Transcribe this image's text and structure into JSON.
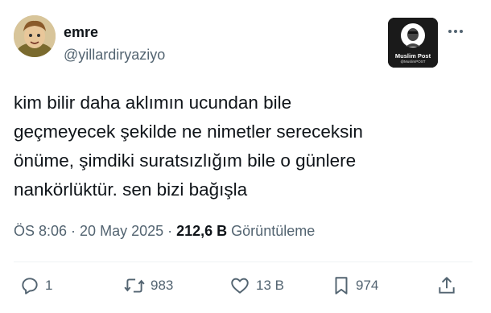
{
  "author": {
    "display_name": "emre",
    "handle": "@yillardiryaziyo",
    "avatar_icon": "cartoon-character-avatar"
  },
  "watermark_badge": {
    "brand": "Muslim Post",
    "sub": "@MuslimPOST"
  },
  "more_icon": "more-horizontal-icon",
  "tweet": {
    "lines": [
      "kim bilir daha aklımın ucundan bile",
      "geçmeyecek şekilde ne nimetler sereceksin",
      "önüme, şimdiki suratsızlığım bile o günlere",
      "nankörlüktür. sen bizi bağışla"
    ]
  },
  "meta": {
    "time": "ÖS 8:06",
    "sep1": " · ",
    "date": "20 May 2025",
    "sep2": " · ",
    "views_count": "212,6 B",
    "views_label": " Görüntüleme"
  },
  "actions": {
    "reply": {
      "icon": "reply-icon",
      "count": "1"
    },
    "retweet": {
      "icon": "retweet-icon",
      "count": "983"
    },
    "like": {
      "icon": "heart-icon",
      "count": "13 B"
    },
    "bookmark": {
      "icon": "bookmark-icon",
      "count": "974"
    },
    "share": {
      "icon": "share-icon"
    }
  },
  "colors": {
    "text": "#0f1419",
    "secondary": "#536471",
    "divider": "#eff3f4"
  }
}
